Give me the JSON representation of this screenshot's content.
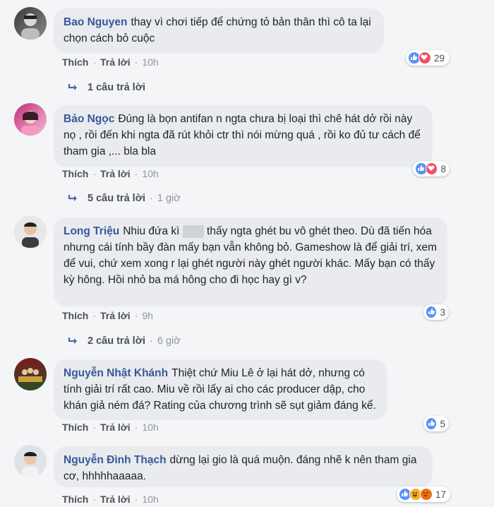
{
  "comments": [
    {
      "author": "Bao Nguyen",
      "text": "thay vì chơi tiếp để chứng tỏ bản thân thì cô ta lại chọn cách bỏ cuộc",
      "like_label": "Thích",
      "reply_label": "Trả lời",
      "time": "10h",
      "reaction_count": "29",
      "reactions": [
        "like-icon",
        "love-icon"
      ],
      "replies_label": "1 câu trả lời",
      "replies_time": ""
    },
    {
      "author": "Bảo Ngọc",
      "text": "Đúng là bọn antifan n ngta chưa bị loại thì chê hát dở rồi này nọ , rồi đến khi ngta đã rút khỏi ctr thì nói mừng quá , rồi ko đủ tư cách để tham gia ,... bla bla",
      "like_label": "Thích",
      "reply_label": "Trả lời",
      "time": "10h",
      "reaction_count": "8",
      "reactions": [
        "like-icon",
        "love-icon"
      ],
      "replies_label": "5 câu trả lời",
      "replies_time": "1 giờ"
    },
    {
      "author": "Long Triệu",
      "text_before": "Nhiu đứa kì",
      "text_after": "thấy ngta ghét bu vô ghét theo. Dù đã tiến hóa nhưng cái tính bầy đàn mấy bạn vẫn không bỏ. Gameshow là để giải trí, xem để vui, chứ xem xong r lại ghét người này ghét người khác. Mấy bạn có thấy kỳ hông. Hồi nhỏ ba má hông cho đi học hay gì v?",
      "like_label": "Thích",
      "reply_label": "Trả lời",
      "time": "9h",
      "reaction_count": "3",
      "reactions": [
        "like-icon"
      ],
      "replies_label": "2 câu trả lời",
      "replies_time": "6 giờ"
    },
    {
      "author": "Nguyễn Nhật Khánh",
      "text": "Thiệt chứ Miu Lê ở lại hát dở, nhưng có tính giải trí rất cao. Miu về rồi lấy ai cho các producer dập, cho khán giả ném đá? Rating của chương trình sẽ sụt giảm đáng kể.",
      "like_label": "Thích",
      "reply_label": "Trả lời",
      "time": "10h",
      "reaction_count": "5",
      "reactions": [
        "like-icon"
      ]
    },
    {
      "author": "Nguyễn Đình Thạch",
      "text": "dừng lại gio là quá muộn. đáng nhẽ k nên tham gia cơ, hhhhhaaaaa.",
      "like_label": "Thích",
      "reply_label": "Trả lời",
      "time": "10h",
      "reaction_count": "17",
      "reactions": [
        "like-icon",
        "haha-icon",
        "angry-icon"
      ]
    }
  ],
  "colors": {
    "author": "#365899",
    "bubble": "#e9ebee",
    "like": "#5890ff",
    "love": "#f25268",
    "haha": "#f7b125",
    "angry": "#e9710f"
  }
}
